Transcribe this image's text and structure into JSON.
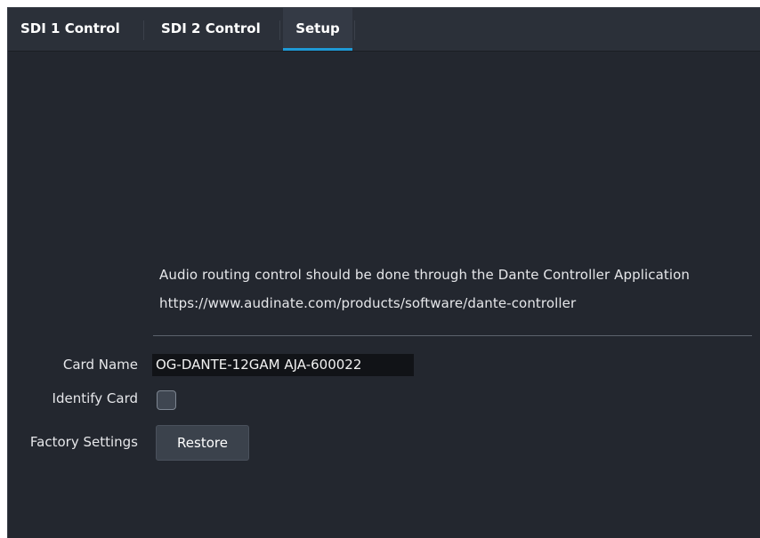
{
  "tabs": [
    {
      "label": "SDI 1 Control",
      "active": false
    },
    {
      "label": "SDI 2 Control",
      "active": false
    },
    {
      "label": "Setup",
      "active": true
    }
  ],
  "setup": {
    "info_line_1": "Audio routing control should be done through the Dante Controller Application",
    "info_line_2": "https://www.audinate.com/products/software/dante-controller",
    "card_name_label": "Card Name",
    "card_name_value": "OG-DANTE-12GAM AJA-600022",
    "identify_card_label": "Identify Card",
    "identify_card_checked": false,
    "factory_settings_label": "Factory Settings",
    "restore_button_label": "Restore"
  },
  "colors": {
    "background": "#23272f",
    "tabbar": "#2b3039",
    "active_tab_accent": "#1e9ad6",
    "field_background": "#111317",
    "button_background": "#3b424c"
  }
}
